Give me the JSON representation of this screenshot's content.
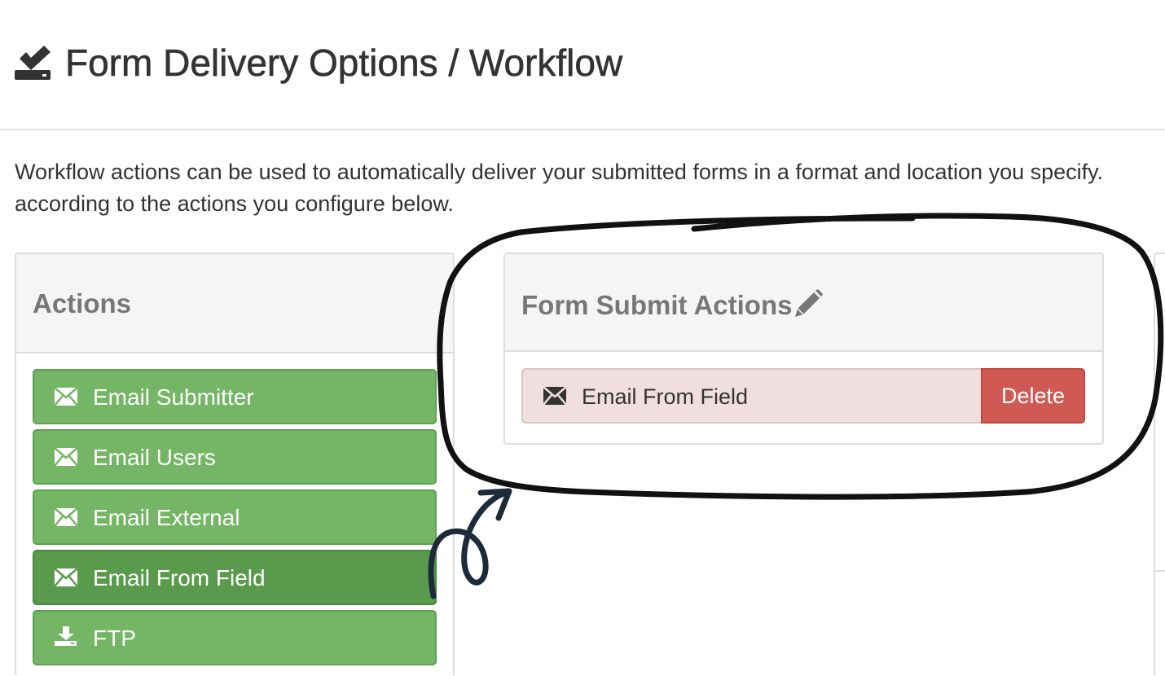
{
  "header": {
    "title": "Form Delivery Options / Workflow",
    "icon": "download-check-icon"
  },
  "intro": {
    "line1": "Workflow actions can be used to automatically deliver your submitted forms in a format and location you specify.",
    "line2": "according to the actions you configure below."
  },
  "actions_panel": {
    "title": "Actions",
    "items": [
      {
        "label": "Email Submitter",
        "icon": "envelope-icon"
      },
      {
        "label": "Email Users",
        "icon": "envelope-icon"
      },
      {
        "label": "Email External",
        "icon": "envelope-icon"
      },
      {
        "label": "Email From Field",
        "icon": "envelope-icon",
        "active": true
      },
      {
        "label": "FTP",
        "icon": "download-icon"
      }
    ]
  },
  "submit_panel": {
    "title": "Form Submit Actions",
    "edit_icon": "pencil-icon",
    "items": [
      {
        "label": "Email From Field",
        "icon": "envelope-icon",
        "delete_label": "Delete"
      }
    ]
  },
  "colors": {
    "action_button": "#74b665",
    "action_button_active": "#5a9a4c",
    "configured_item_bg": "#f1dedf",
    "delete_button": "#d05a53",
    "annotation_stroke": "#111111",
    "annotation_arrow": "#1c2a3a"
  }
}
